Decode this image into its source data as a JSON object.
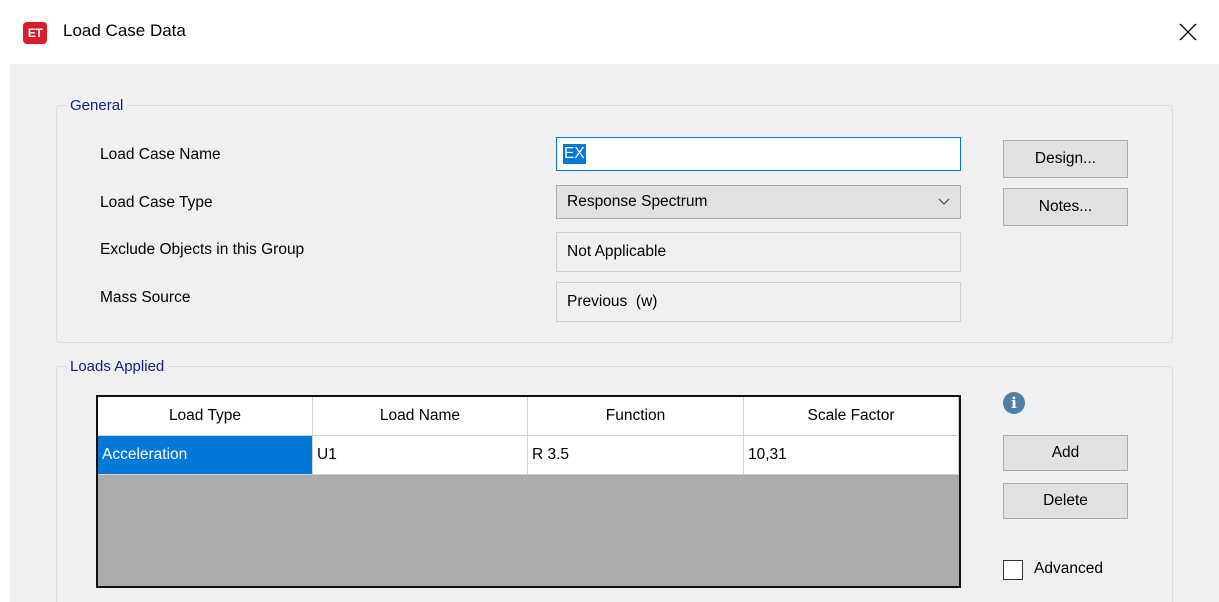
{
  "window": {
    "app_icon_text": "ET",
    "title": "Load Case Data"
  },
  "general": {
    "legend": "General",
    "load_case_name_label": "Load Case Name",
    "load_case_name_value": "EX",
    "load_case_type_label": "Load Case Type",
    "load_case_type_value": "Response Spectrum",
    "exclude_objects_label": "Exclude Objects in this Group",
    "exclude_objects_value": "Not Applicable",
    "mass_source_label": "Mass Source",
    "mass_source_value": "Previous  (w)",
    "design_button": "Design...",
    "notes_button": "Notes..."
  },
  "loads_applied": {
    "legend": "Loads Applied",
    "columns": [
      "Load Type",
      "Load Name",
      "Function",
      "Scale Factor"
    ],
    "rows": [
      [
        "Acceleration",
        "U1",
        "R 3.5",
        "10,31"
      ]
    ],
    "add_button": "Add",
    "delete_button": "Delete",
    "advanced_label": "Advanced",
    "advanced_checked": false
  },
  "colors": {
    "app_icon": "#d81e2a",
    "group_legend": "#0f1e8c",
    "selection": "#0078d7",
    "grid_empty": "#ababab",
    "info_icon": "#4f7fa6"
  },
  "icons": {
    "close": "close-icon",
    "dropdown": "chevron-down-icon",
    "info": "info-icon"
  }
}
